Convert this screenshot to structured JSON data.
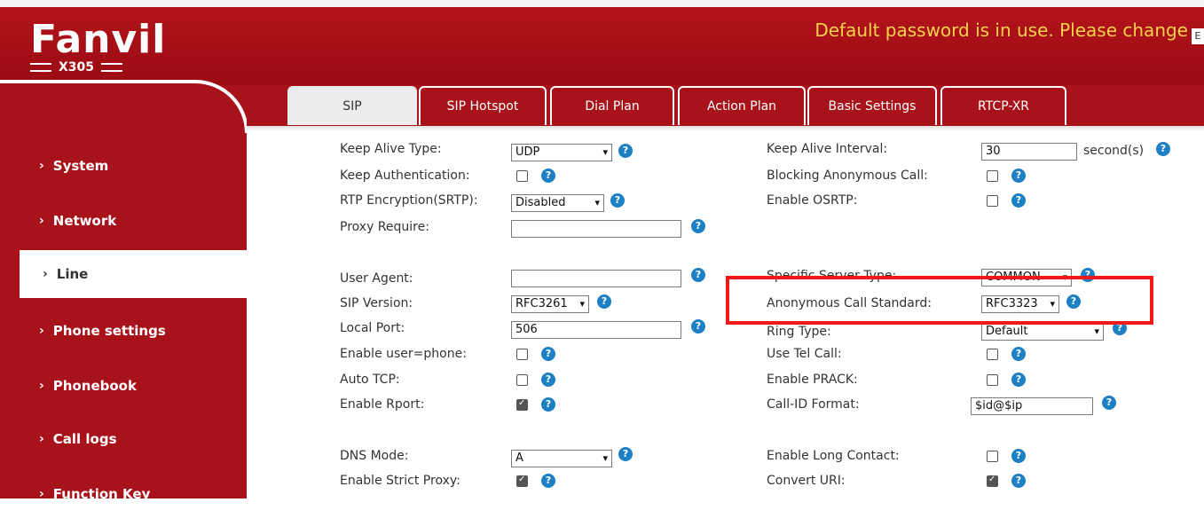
{
  "header": {
    "brand": "Fanvil",
    "model": "X305",
    "warning": "Default password is in use. Please change",
    "warning_cut": "E"
  },
  "sidebar": {
    "items": [
      {
        "label": "System"
      },
      {
        "label": "Network"
      },
      {
        "label": "Line"
      },
      {
        "label": "Phone settings"
      },
      {
        "label": "Phonebook"
      },
      {
        "label": "Call logs"
      },
      {
        "label": "Function Key"
      }
    ],
    "active": "Line"
  },
  "tabs": [
    {
      "label": "SIP"
    },
    {
      "label": "SIP Hotspot"
    },
    {
      "label": "Dial Plan"
    },
    {
      "label": "Action Plan"
    },
    {
      "label": "Basic Settings"
    },
    {
      "label": "RTCP-XR"
    }
  ],
  "active_tab": "SIP",
  "form": {
    "keep_alive_type": {
      "label": "Keep Alive Type:",
      "value": "UDP"
    },
    "keep_alive_interval": {
      "label": "Keep Alive Interval:",
      "value": "30",
      "unit": "second(s)"
    },
    "keep_authentication": {
      "label": "Keep Authentication:",
      "checked": false
    },
    "blocking_anonymous_call": {
      "label": "Blocking Anonymous Call:",
      "checked": false
    },
    "rtp_encryption": {
      "label": "RTP Encryption(SRTP):",
      "value": "Disabled"
    },
    "enable_osrtp": {
      "label": "Enable OSRTP:",
      "checked": false
    },
    "proxy_require": {
      "label": "Proxy Require:",
      "value": ""
    },
    "user_agent": {
      "label": "User Agent:",
      "value": ""
    },
    "specific_server_type": {
      "label": "Specific Server Type:",
      "value": "COMMON"
    },
    "sip_version": {
      "label": "SIP Version:",
      "value": "RFC3261"
    },
    "anonymous_call_standard": {
      "label": "Anonymous Call Standard:",
      "value": "RFC3323"
    },
    "local_port": {
      "label": "Local Port:",
      "value": "506"
    },
    "ring_type": {
      "label": "Ring Type:",
      "value": "Default"
    },
    "enable_user_phone": {
      "label": "Enable user=phone:",
      "checked": false
    },
    "use_tel_call": {
      "label": "Use Tel Call:",
      "checked": false
    },
    "auto_tcp": {
      "label": "Auto TCP:",
      "checked": false
    },
    "enable_prack": {
      "label": "Enable PRACK:",
      "checked": false
    },
    "enable_rport": {
      "label": "Enable Rport:",
      "checked": true
    },
    "call_id_format": {
      "label": "Call-ID Format:",
      "value": "$id@$ip"
    },
    "dns_mode": {
      "label": "DNS Mode:",
      "value": "A"
    },
    "enable_long_contact": {
      "label": "Enable Long Contact:",
      "checked": false
    },
    "enable_strict_proxy": {
      "label": "Enable Strict Proxy:",
      "checked": true
    },
    "convert_uri": {
      "label": "Convert URI:",
      "checked": true
    }
  },
  "help_glyph": "?",
  "colors": {
    "brand_red": "#a8121a",
    "warning_text": "#f5d34a",
    "help_blue": "#1d7fc4",
    "highlight_red": "#ee1a1a"
  }
}
